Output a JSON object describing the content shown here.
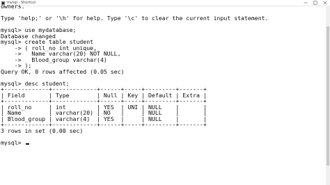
{
  "window": {
    "title": "mysql - Shortcut"
  },
  "console": {
    "lines": [
      "owners.",
      "",
      "Type 'help;' or '\\h' for help. Type '\\c' to clear the current input statement.",
      "",
      "mysql> use mydatabase;",
      "Database changed",
      "mysql> create table student",
      "    -> ( roll_no int unique,",
      "    ->   Name varchar(20) NOT NULL,",
      "    ->   Blood_group varchar(4)",
      "    -> );",
      "Query OK, 0 rows affected (0.05 sec)",
      "",
      "mysql> desc student;",
      "+-------------+-------------+------+-----+---------+-------+",
      "| Field       | Type        | Null | Key | Default | Extra |",
      "+-------------+-------------+------+-----+---------+-------+",
      "| roll_no     | int         | YES  | UNI | NULL    |       |",
      "| Name        | varchar(20) | NO   |     | NULL    |       |",
      "| Blood_group | varchar(4)  | YES  |     | NULL    |       |",
      "+-------------+-------------+------+-----+---------+-------+",
      "3 rows in set (0.00 sec)",
      "",
      "mysql> "
    ]
  },
  "icons": {
    "app": "console-icon",
    "minimize": "minimize-icon",
    "maximize": "maximize-icon",
    "close": "close-icon"
  },
  "colors": {
    "background": "#ffffff",
    "text": "#0c0c0c"
  }
}
